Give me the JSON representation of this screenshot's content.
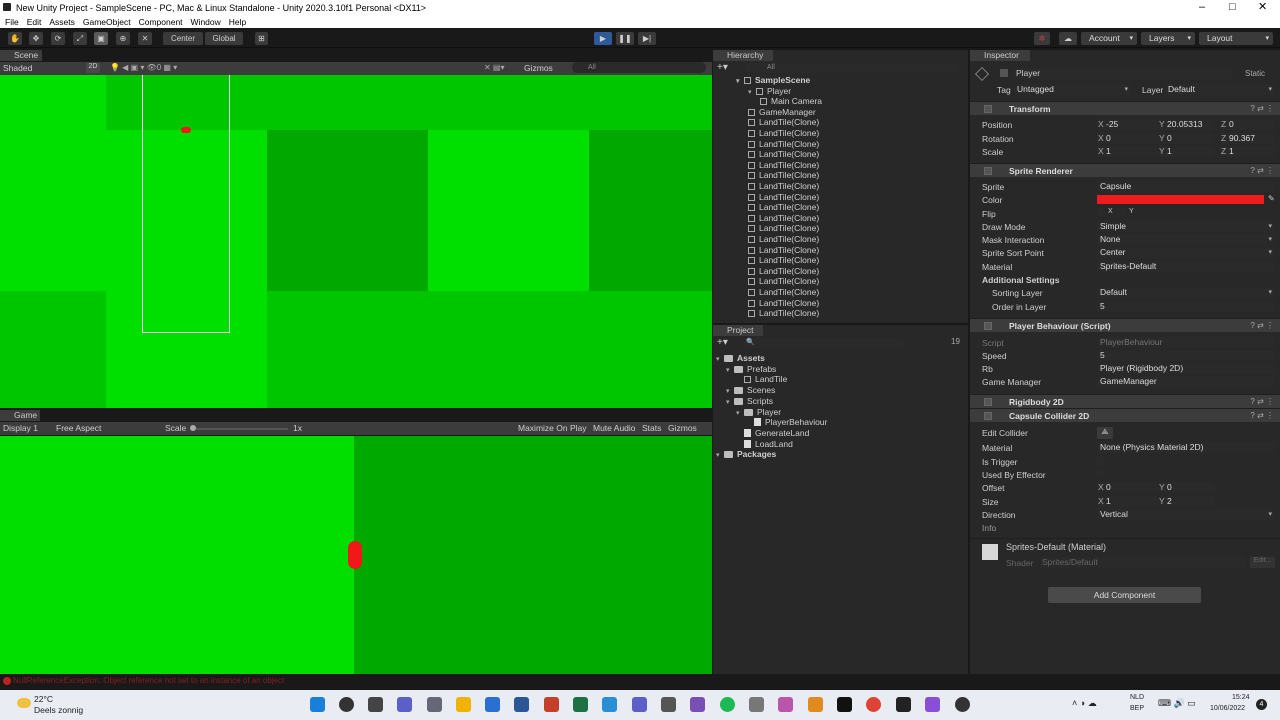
{
  "window": {
    "title": "New Unity Project - SampleScene - PC, Mac & Linux Standalone - Unity 2020.3.10f1 Personal <DX11>",
    "minimize": "–",
    "maximize": "□",
    "close": "✕"
  },
  "menu": [
    "File",
    "Edit",
    "Assets",
    "GameObject",
    "Component",
    "Window",
    "Help"
  ],
  "toolbar": {
    "pivot": "Center",
    "space": "Global",
    "account": "Account",
    "layers": "Layers",
    "layout": "Layout"
  },
  "scene": {
    "tab": "Scene",
    "shade_mode": "Shaded",
    "two_d": "2D",
    "gizmos": "Gizmos",
    "search": "All",
    "colors": {
      "light": "#00e000",
      "mid": "#00c600",
      "dark": "#00a800"
    }
  },
  "game": {
    "tab": "Game",
    "display": "Display 1",
    "aspect": "Free Aspect",
    "scale_label": "Scale",
    "scale_value": "1x",
    "maximize": "Maximize On Play",
    "mute": "Mute Audio",
    "stats": "Stats",
    "gizmos": "Gizmos",
    "colors": {
      "left": "#00df00",
      "right": "#00a900",
      "player": "#f01818"
    }
  },
  "hierarchy": {
    "tab": "Hierarchy",
    "search": "All",
    "items": [
      "SampleScene",
      "Player",
      "Main Camera",
      "GameManager",
      "LandTile(Clone)",
      "LandTile(Clone)",
      "LandTile(Clone)",
      "LandTile(Clone)",
      "LandTile(Clone)",
      "LandTile(Clone)",
      "LandTile(Clone)",
      "LandTile(Clone)",
      "LandTile(Clone)",
      "LandTile(Clone)",
      "LandTile(Clone)",
      "LandTile(Clone)",
      "LandTile(Clone)",
      "LandTile(Clone)",
      "LandTile(Clone)",
      "LandTile(Clone)",
      "LandTile(Clone)",
      "LandTile(Clone)",
      "LandTile(Clone)"
    ]
  },
  "project": {
    "tab": "Project",
    "count": "19",
    "items": [
      "Assets",
      "Prefabs",
      "LandTile",
      "Scenes",
      "Scripts",
      "Player",
      "PlayerBehaviour",
      "GenerateLand",
      "LoadLand",
      "Packages"
    ]
  },
  "inspector": {
    "tab": "Inspector",
    "object_name": "Player",
    "static": "Static",
    "tag_label": "Tag",
    "tag": "Untagged",
    "layer_label": "Layer",
    "layer": "Default",
    "transform": {
      "title": "Transform",
      "position_label": "Position",
      "rotation_label": "Rotation",
      "scale_label": "Scale",
      "pos": [
        "-25",
        "20.05313",
        "0"
      ],
      "rot": [
        "0",
        "0",
        "90.367"
      ],
      "scale": [
        "1",
        "1",
        "1"
      ],
      "axes": [
        "X",
        "Y",
        "Z"
      ]
    },
    "sprite_renderer": {
      "title": "Sprite Renderer",
      "labels": [
        "Sprite",
        "Color",
        "Flip",
        "Draw Mode",
        "Mask Interaction",
        "Sprite Sort Point",
        "Material"
      ],
      "sprite": "Capsule",
      "color": "#ee1c1c",
      "flip_x": "X",
      "flip_y": "Y",
      "draw_mode": "Simple",
      "mask": "None",
      "sort_point": "Center",
      "material": "Sprites-Default",
      "additional": "Additional Settings",
      "sorting_layer_label": "Sorting Layer",
      "sorting_layer": "Default",
      "order_label": "Order in Layer",
      "order": "5"
    },
    "script": {
      "title": "Player Behaviour (Script)",
      "labels": [
        "Script",
        "Speed",
        "Rb",
        "Game Manager"
      ],
      "script": "PlayerBehaviour",
      "speed": "5",
      "rb": "Player (Rigidbody 2D)",
      "gm": "GameManager"
    },
    "rigidbody": {
      "title": "Rigidbody 2D"
    },
    "collider": {
      "title": "Capsule Collider 2D",
      "labels": [
        "Edit Collider",
        "Material",
        "Is Trigger",
        "Used By Effector",
        "Offset",
        "Size",
        "Direction"
      ],
      "material": "None (Physics Material 2D)",
      "offset": [
        "0",
        "0"
      ],
      "size": [
        "1",
        "2"
      ],
      "direction": "Vertical",
      "info": "Info"
    },
    "material": {
      "title": "Sprites-Default (Material)",
      "shader_label": "Shader",
      "shader": "Sprites/Default",
      "edit": "Edit..."
    },
    "add_component": "Add Component"
  },
  "status": {
    "error": "NullReferenceException: Object reference not set to an instance of an object"
  },
  "taskbar": {
    "temp": "22°C",
    "weather": "Deels zonnig",
    "lang": "NLD",
    "region": "BEP",
    "time": "15:24",
    "date": "10/06/2022",
    "badge": "4"
  }
}
